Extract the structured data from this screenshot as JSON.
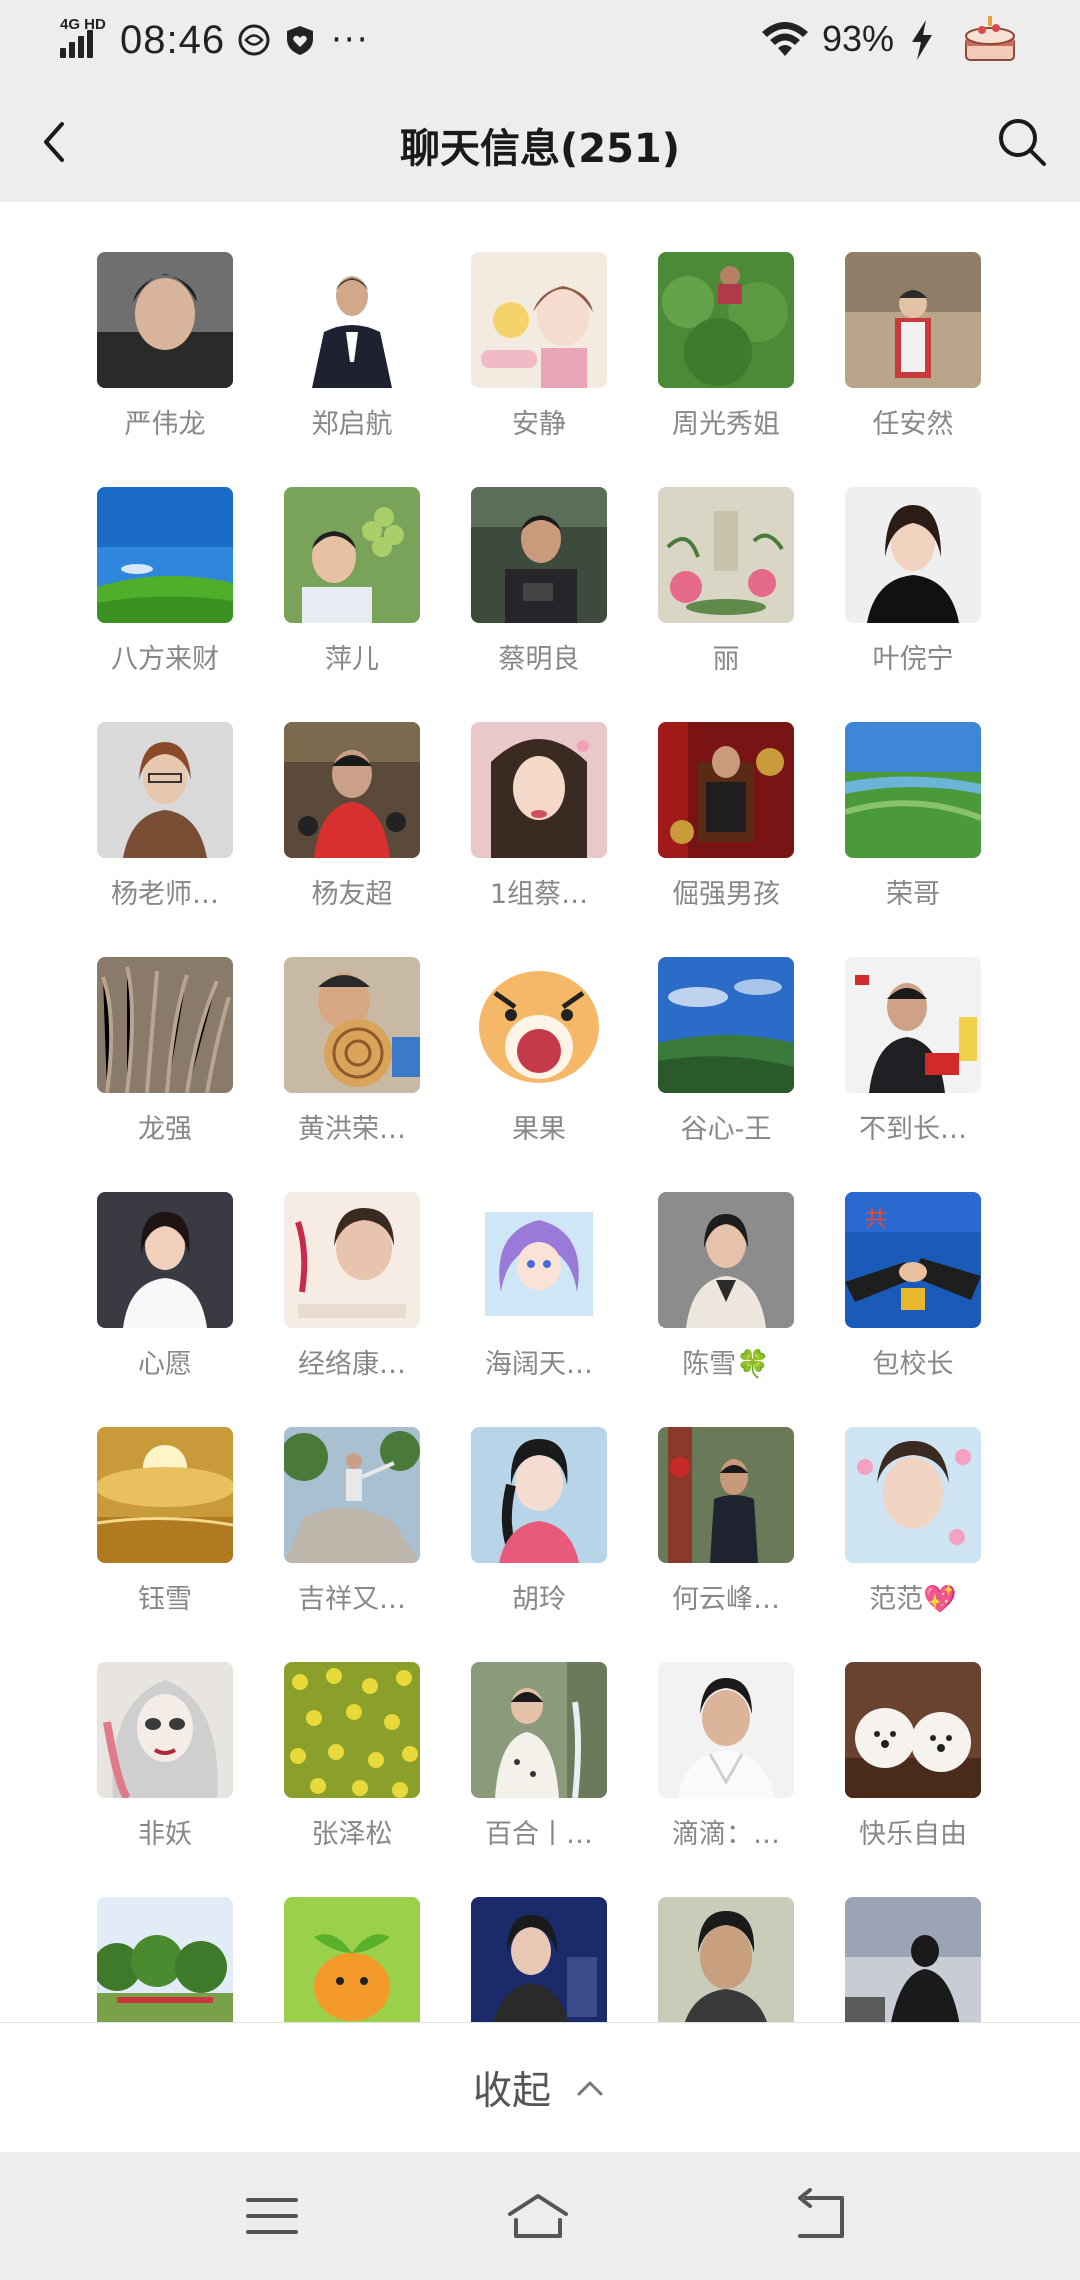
{
  "status_bar": {
    "network": "4G HD",
    "time": "08:46",
    "more": "···",
    "battery": "93%",
    "icons": [
      "signal-icon",
      "data-saver-icon",
      "shield-heart-icon",
      "wifi-icon",
      "charging-bolt-icon",
      "cake-icon"
    ]
  },
  "nav": {
    "title": "聊天信息(251)",
    "back_icon": "chevron-left-icon",
    "search_icon": "search-icon"
  },
  "members": [
    {
      "name": "严伟龙"
    },
    {
      "name": "郑启航"
    },
    {
      "name": "安静"
    },
    {
      "name": "周光秀姐"
    },
    {
      "name": "任安然"
    },
    {
      "name": "八方来财"
    },
    {
      "name": "萍儿"
    },
    {
      "name": "蔡明良"
    },
    {
      "name": "丽"
    },
    {
      "name": "叶俒宁"
    },
    {
      "name": "杨老师…"
    },
    {
      "name": "杨友超"
    },
    {
      "name": "1组蔡…"
    },
    {
      "name": "倔强男孩"
    },
    {
      "name": "荣哥"
    },
    {
      "name": "龙强"
    },
    {
      "name": "黄洪荣…"
    },
    {
      "name": "果果"
    },
    {
      "name": "谷心-王"
    },
    {
      "name": "不到长…"
    },
    {
      "name": "心愿"
    },
    {
      "name": "经络康…"
    },
    {
      "name": "海阔天…"
    },
    {
      "name": "陈雪🍀"
    },
    {
      "name": "包校长"
    },
    {
      "name": "钰雪"
    },
    {
      "name": "吉祥又…"
    },
    {
      "name": "胡玲"
    },
    {
      "name": "何云峰…"
    },
    {
      "name": "范范💖"
    },
    {
      "name": "非妖"
    },
    {
      "name": "张泽松"
    },
    {
      "name": "百合丨…"
    },
    {
      "name": "滴滴：…"
    },
    {
      "name": "快乐自由"
    },
    {
      "name": ""
    },
    {
      "name": ""
    },
    {
      "name": ""
    },
    {
      "name": ""
    },
    {
      "name": ""
    }
  ],
  "collapse": {
    "label": "收起",
    "icon": "chevron-up-icon"
  },
  "system_nav": {
    "icons": [
      "menu-icon",
      "home-icon",
      "back-icon"
    ]
  },
  "colors": {
    "header_bg": "#ededed",
    "name_text": "#888888",
    "title_text": "#1a1a1a"
  }
}
